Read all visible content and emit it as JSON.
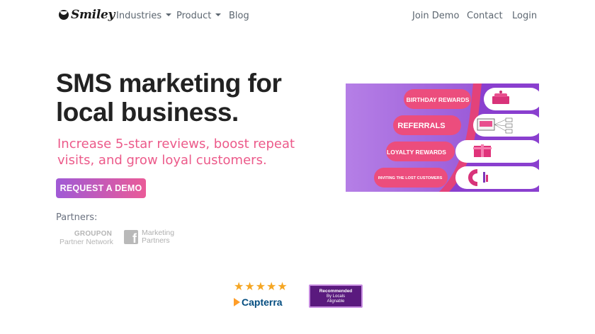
{
  "brand": {
    "name": "Smiley"
  },
  "nav": {
    "industries": "Industries",
    "product": "Product",
    "blog": "Blog",
    "join_demo": "Join Demo",
    "contact": "Contact",
    "login": "Login"
  },
  "hero": {
    "title": "SMS marketing for local business.",
    "subtitle": "Increase 5-star reviews, boost repeat visits, and grow loyal customers.",
    "cta": "REQUEST A DEMO"
  },
  "partners": {
    "label": "Partners:",
    "groupon_top": "GROUPON",
    "groupon_bottom": "Partner Network",
    "facebook_line1": "Marketing",
    "facebook_line2": "Partners"
  },
  "hero_image": {
    "items": [
      {
        "label": "BIRTHDAY REWARDS",
        "icon": "cake-icon"
      },
      {
        "label": "REFERRALS",
        "icon": "referral-network-icon"
      },
      {
        "label": "LOYALTY REWARDS",
        "icon": "gift-icon"
      },
      {
        "label": "INVITING THE LOST CUSTOMERS",
        "icon": "magnet-icon"
      }
    ],
    "colors": {
      "purple": "#a666dc",
      "pink": "#ec4d7d",
      "white": "#ffffff"
    }
  },
  "badges": {
    "capterra": {
      "rating_stars": 5,
      "name": "Capterra"
    },
    "locals": {
      "line1": "Recommended",
      "line2": "By Locals",
      "line3": "Alignable"
    }
  },
  "colors": {
    "accent_pink": "#ec5a8a",
    "cta_gradient_start": "#a05ad6",
    "cta_gradient_end": "#ea5b98",
    "star": "#f5a623"
  }
}
